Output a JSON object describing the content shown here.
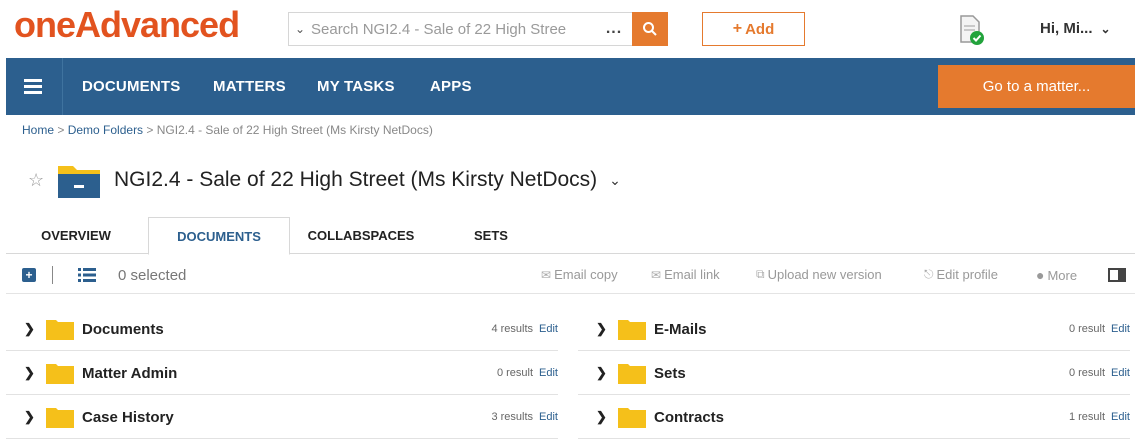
{
  "header": {
    "logo": "oneAdvanced",
    "search_placeholder": "Search NGI2.4 - Sale of 22 High Stree",
    "search_more": "...",
    "add_label": "Add",
    "user_label": "Hi, Mi..."
  },
  "nav": {
    "items": [
      {
        "label": "DOCUMENTS"
      },
      {
        "label": "MATTERS"
      },
      {
        "label": "MY TASKS"
      },
      {
        "label": "APPS"
      }
    ],
    "goto_label": "Go to a matter..."
  },
  "breadcrumb": {
    "home": "Home",
    "sep1": " > ",
    "demo": "Demo Folders",
    "sep2": " > ",
    "current": "NGI2.4 - Sale of 22 High Street (Ms Kirsty NetDocs)"
  },
  "page": {
    "title": "NGI2.4 - Sale of 22 High Street (Ms Kirsty NetDocs)"
  },
  "tabs": [
    {
      "label": "OVERVIEW",
      "active": false
    },
    {
      "label": "DOCUMENTS",
      "active": true
    },
    {
      "label": "COLLABSPACES",
      "active": false
    },
    {
      "label": "SETS",
      "active": false
    }
  ],
  "toolbar": {
    "selected": "0 selected",
    "email_copy": "Email copy",
    "email_link": "Email link",
    "upload_new_version": "Upload new version",
    "edit_profile": "Edit profile",
    "more": "More"
  },
  "folders_left": [
    {
      "name": "Documents",
      "count": "4 results",
      "edit": "Edit"
    },
    {
      "name": "Matter Admin",
      "count": "0 result",
      "edit": "Edit"
    },
    {
      "name": "Case History",
      "count": "3 results",
      "edit": "Edit"
    }
  ],
  "folders_right": [
    {
      "name": "E-Mails",
      "count": "0 result",
      "edit": "Edit"
    },
    {
      "name": "Sets",
      "count": "0 result",
      "edit": "Edit"
    },
    {
      "name": "Contracts",
      "count": "1 result",
      "edit": "Edit"
    }
  ],
  "colors": {
    "brand_orange": "#e57a2e",
    "logo_orange": "#e2531f",
    "nav_blue": "#2c5f8e",
    "folder_yellow": "#f5c01a",
    "status_green": "#22a33c"
  }
}
